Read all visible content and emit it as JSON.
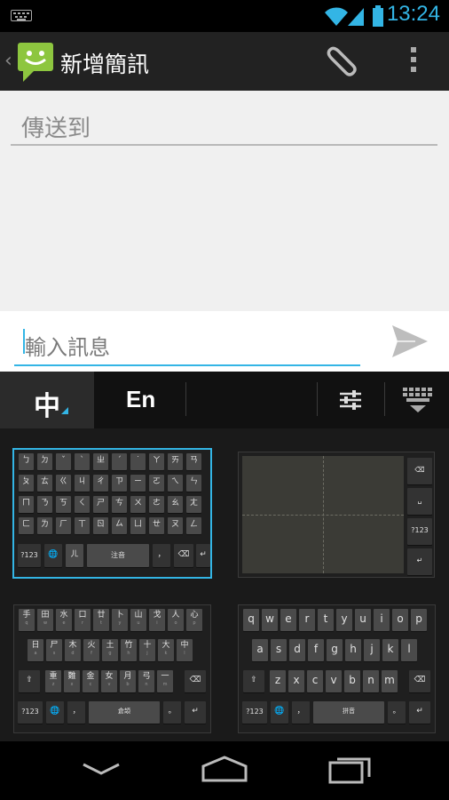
{
  "status_bar": {
    "time": "13:24",
    "icons": [
      "keyboard-icon",
      "wifi-icon",
      "signal-icon",
      "battery-icon"
    ]
  },
  "action_bar": {
    "title": "新增簡訊",
    "icons": [
      "app-logo-icon",
      "attach-icon",
      "overflow-menu-icon"
    ]
  },
  "compose": {
    "to_placeholder": "傳送到",
    "message_placeholder": "輸入訊息"
  },
  "ime_bar": {
    "tab_chinese": "中",
    "tab_english": "En"
  },
  "keyboards": {
    "zhuyin": {
      "rows": [
        [
          "ㄅ",
          "ㄉ",
          "ˇ",
          "ˋ",
          "ㄓ",
          "ˊ",
          "˙",
          "ㄚ",
          "ㄞ",
          "ㄢ"
        ],
        [
          "ㄆ",
          "ㄊ",
          "ㄍ",
          "ㄐ",
          "ㄔ",
          "ㄗ",
          "ㄧ",
          "ㄛ",
          "ㄟ",
          "ㄣ"
        ],
        [
          "ㄇ",
          "ㄋ",
          "ㄎ",
          "ㄑ",
          "ㄕ",
          "ㄘ",
          "ㄨ",
          "ㄜ",
          "ㄠ",
          "ㄤ"
        ],
        [
          "ㄈ",
          "ㄌ",
          "ㄏ",
          "ㄒ",
          "ㄖ",
          "ㄙ",
          "ㄩ",
          "ㄝ",
          "ㄡ",
          "ㄥ"
        ]
      ],
      "bottom": [
        "?123",
        "🌐",
        "ㄦ",
        "注音",
        "，",
        "⌫",
        "↵"
      ]
    },
    "cangjie": {
      "rows": [
        [
          "手",
          "田",
          "水",
          "口",
          "廿",
          "卜",
          "山",
          "戈",
          "人",
          "心"
        ],
        [
          "日",
          "尸",
          "木",
          "火",
          "土",
          "竹",
          "十",
          "大",
          "中"
        ],
        [
          "重",
          "難",
          "金",
          "女",
          "月",
          "弓",
          "一"
        ]
      ],
      "row1_sub": [
        "q",
        "w",
        "e",
        "r",
        "t",
        "y",
        "u",
        "i",
        "o",
        "p"
      ],
      "row2_sub": [
        "a",
        "s",
        "d",
        "f",
        "g",
        "h",
        "j",
        "k",
        "l"
      ],
      "row3_sub": [
        "z",
        "x",
        "c",
        "v",
        "b",
        "n",
        "m"
      ],
      "bottom": [
        "?123",
        "🌐",
        "，",
        "倉頡",
        "。",
        "↵"
      ]
    },
    "pinyin": {
      "rows": [
        [
          "q",
          "w",
          "e",
          "r",
          "t",
          "y",
          "u",
          "i",
          "o",
          "p"
        ],
        [
          "a",
          "s",
          "d",
          "f",
          "g",
          "h",
          "j",
          "k",
          "l"
        ],
        [
          "z",
          "x",
          "c",
          "v",
          "b",
          "n",
          "m"
        ]
      ],
      "bottom": [
        "?123",
        "🌐",
        "，",
        "拼音",
        "。",
        "↵"
      ]
    },
    "handwriting": {
      "side_keys": [
        "⌫",
        "␣",
        "?123",
        "↵"
      ]
    }
  },
  "nav_bar": {
    "icons": [
      "back-icon",
      "home-icon",
      "recent-apps-icon"
    ]
  },
  "colors": {
    "accent": "#33b5e5",
    "app_green": "#8dc63f"
  }
}
